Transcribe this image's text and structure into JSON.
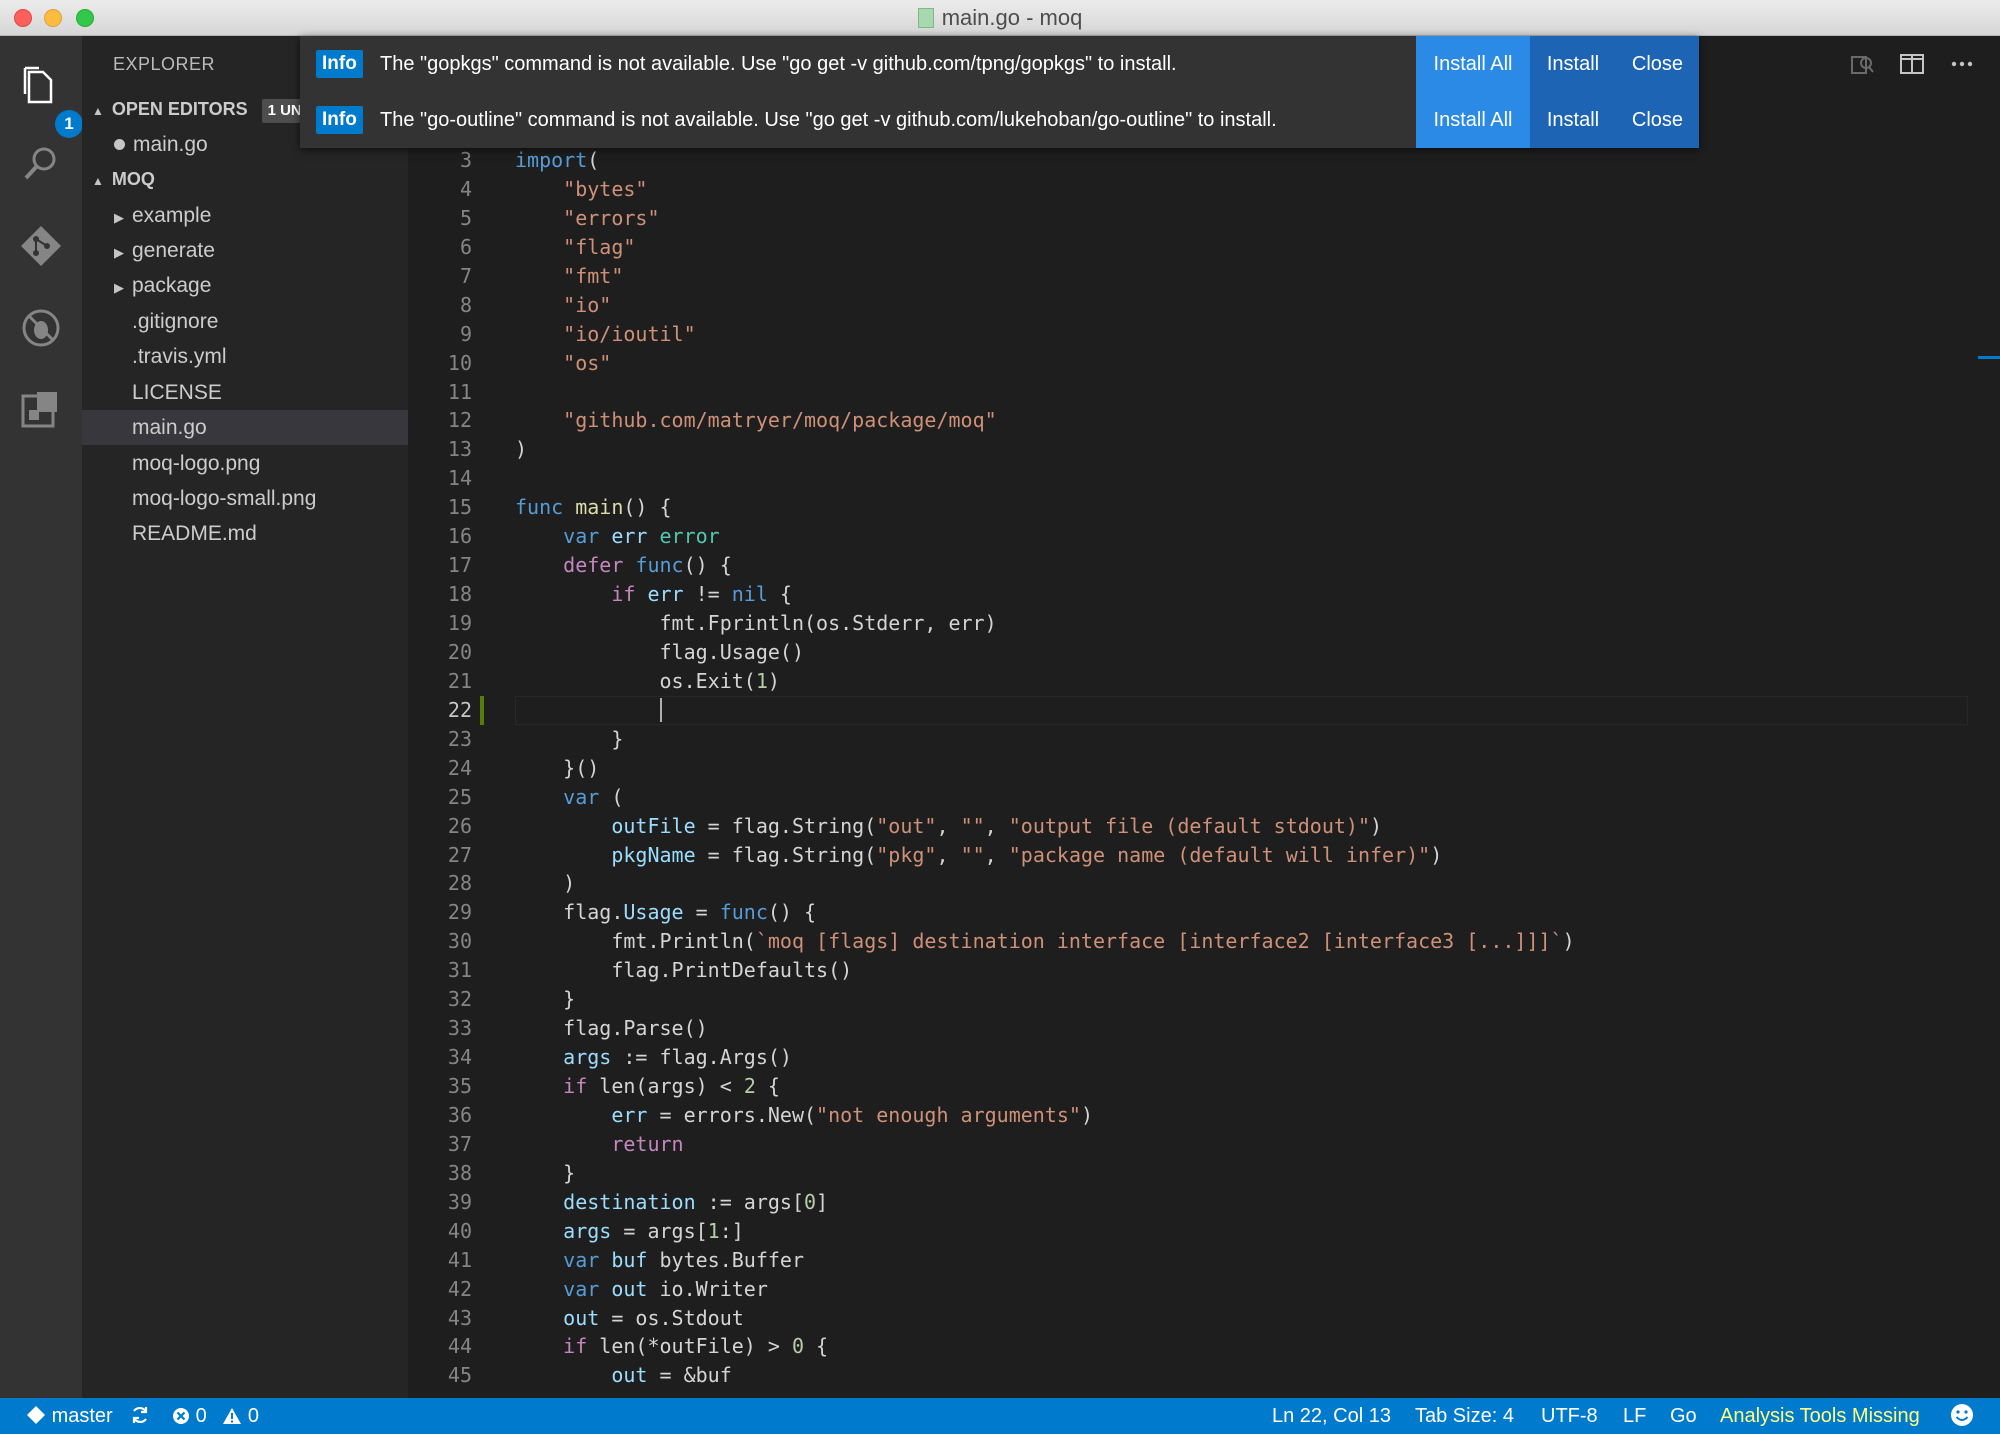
{
  "window": {
    "title": "main.go - moq"
  },
  "activity": {
    "explorer_badge": "1"
  },
  "sidebar": {
    "title": "EXPLORER",
    "open_editors": {
      "label": "OPEN EDITORS",
      "badge": "1 UN",
      "files": [
        {
          "name": "main.go"
        }
      ]
    },
    "folder": {
      "label": "MOQ",
      "items": [
        {
          "name": "example",
          "type": "folder"
        },
        {
          "name": "generate",
          "type": "folder"
        },
        {
          "name": "package",
          "type": "folder"
        },
        {
          "name": ".gitignore",
          "type": "file"
        },
        {
          "name": ".travis.yml",
          "type": "file"
        },
        {
          "name": "LICENSE",
          "type": "file"
        },
        {
          "name": "main.go",
          "type": "file",
          "selected": true
        },
        {
          "name": "moq-logo.png",
          "type": "file"
        },
        {
          "name": "moq-logo-small.png",
          "type": "file"
        },
        {
          "name": "README.md",
          "type": "file"
        }
      ]
    }
  },
  "notifications": [
    {
      "tag": "Info",
      "message": "The \"gopkgs\" command is not available. Use \"go get -v github.com/tpng/gopkgs\" to install.",
      "install_all": "Install All",
      "install": "Install",
      "close": "Close"
    },
    {
      "tag": "Info",
      "message": "The \"go-outline\" command is not available. Use \"go get -v github.com/lukehoban/go-outline\" to install.",
      "install_all": "Install All",
      "install": "Install",
      "close": "Close"
    }
  ],
  "editor": {
    "first_line": 3,
    "current_line": 22,
    "lines": [
      [
        [
          "kw",
          "import"
        ],
        [
          "",
          "("
        ]
      ],
      [
        [
          "",
          "    "
        ],
        [
          "str",
          "\"bytes\""
        ]
      ],
      [
        [
          "",
          "    "
        ],
        [
          "str",
          "\"errors\""
        ]
      ],
      [
        [
          "",
          "    "
        ],
        [
          "str",
          "\"flag\""
        ]
      ],
      [
        [
          "",
          "    "
        ],
        [
          "str",
          "\"fmt\""
        ]
      ],
      [
        [
          "",
          "    "
        ],
        [
          "str",
          "\"io\""
        ]
      ],
      [
        [
          "",
          "    "
        ],
        [
          "str",
          "\"io/ioutil\""
        ]
      ],
      [
        [
          "",
          "    "
        ],
        [
          "str",
          "\"os\""
        ]
      ],
      [],
      [
        [
          "",
          "    "
        ],
        [
          "str",
          "\"github.com/matryer/moq/package/moq\""
        ]
      ],
      [
        [
          "",
          ")"
        ]
      ],
      [],
      [
        [
          "kw",
          "func"
        ],
        [
          "",
          " "
        ],
        [
          "fn",
          "main"
        ],
        [
          "",
          "() {"
        ]
      ],
      [
        [
          "",
          "    "
        ],
        [
          "kw",
          "var"
        ],
        [
          "",
          " "
        ],
        [
          "var",
          "err"
        ],
        [
          "",
          " "
        ],
        [
          "typ",
          "error"
        ]
      ],
      [
        [
          "",
          "    "
        ],
        [
          "ctl",
          "defer"
        ],
        [
          "",
          " "
        ],
        [
          "kw",
          "func"
        ],
        [
          "",
          "() {"
        ]
      ],
      [
        [
          "",
          "        "
        ],
        [
          "ctl",
          "if"
        ],
        [
          "",
          " "
        ],
        [
          "var",
          "err"
        ],
        [
          "",
          " != "
        ],
        [
          "kw",
          "nil"
        ],
        [
          "",
          " {"
        ]
      ],
      [
        [
          "",
          "            fmt.Fprintln(os.Stderr, err)"
        ]
      ],
      [
        [
          "",
          "            flag.Usage()"
        ]
      ],
      [
        [
          "",
          "            os.Exit("
        ],
        [
          "num",
          "1"
        ],
        [
          "",
          ")"
        ]
      ],
      [
        [
          "",
          "            "
        ],
        [
          "cursor",
          ""
        ]
      ],
      [
        [
          "",
          "        }"
        ]
      ],
      [
        [
          "",
          "    }()"
        ]
      ],
      [
        [
          "",
          "    "
        ],
        [
          "kw",
          "var"
        ],
        [
          "",
          " ("
        ]
      ],
      [
        [
          "",
          "        "
        ],
        [
          "var",
          "outFile"
        ],
        [
          "",
          " = flag.String("
        ],
        [
          "str",
          "\"out\""
        ],
        [
          "",
          ", "
        ],
        [
          "str",
          "\"\""
        ],
        [
          "",
          ", "
        ],
        [
          "str",
          "\"output file (default stdout)\""
        ],
        [
          "",
          ")"
        ]
      ],
      [
        [
          "",
          "        "
        ],
        [
          "var",
          "pkgName"
        ],
        [
          "",
          " = flag.String("
        ],
        [
          "str",
          "\"pkg\""
        ],
        [
          "",
          ", "
        ],
        [
          "str",
          "\"\""
        ],
        [
          "",
          ", "
        ],
        [
          "str",
          "\"package name (default will infer)\""
        ],
        [
          "",
          ")"
        ]
      ],
      [
        [
          "",
          "    )"
        ]
      ],
      [
        [
          "",
          "    flag."
        ],
        [
          "var",
          "Usage"
        ],
        [
          "",
          " = "
        ],
        [
          "kw",
          "func"
        ],
        [
          "",
          "() {"
        ]
      ],
      [
        [
          "",
          "        fmt.Println("
        ],
        [
          "str",
          "`moq [flags] destination interface [interface2 [interface3 [...]]]`"
        ],
        [
          "",
          ")"
        ]
      ],
      [
        [
          "",
          "        flag.PrintDefaults()"
        ]
      ],
      [
        [
          "",
          "    }"
        ]
      ],
      [
        [
          "",
          "    flag.Parse()"
        ]
      ],
      [
        [
          "",
          "    "
        ],
        [
          "var",
          "args"
        ],
        [
          "",
          " := flag.Args()"
        ]
      ],
      [
        [
          "",
          "    "
        ],
        [
          "ctl",
          "if"
        ],
        [
          "",
          " len(args) < "
        ],
        [
          "num",
          "2"
        ],
        [
          "",
          " {"
        ]
      ],
      [
        [
          "",
          "        "
        ],
        [
          "var",
          "err"
        ],
        [
          "",
          " = errors.New("
        ],
        [
          "str",
          "\"not enough arguments\""
        ],
        [
          "",
          ")"
        ]
      ],
      [
        [
          "",
          "        "
        ],
        [
          "ctl",
          "return"
        ]
      ],
      [
        [
          "",
          "    }"
        ]
      ],
      [
        [
          "",
          "    "
        ],
        [
          "var",
          "destination"
        ],
        [
          "",
          " := args["
        ],
        [
          "num",
          "0"
        ],
        [
          "",
          "]"
        ]
      ],
      [
        [
          "",
          "    "
        ],
        [
          "var",
          "args"
        ],
        [
          "",
          " = args["
        ],
        [
          "num",
          "1"
        ],
        [
          "",
          ":]"
        ]
      ],
      [
        [
          "",
          "    "
        ],
        [
          "kw",
          "var"
        ],
        [
          "",
          " "
        ],
        [
          "var",
          "buf"
        ],
        [
          "",
          " bytes.Buffer"
        ]
      ],
      [
        [
          "",
          "    "
        ],
        [
          "kw",
          "var"
        ],
        [
          "",
          " "
        ],
        [
          "var",
          "out"
        ],
        [
          "",
          " io.Writer"
        ]
      ],
      [
        [
          "",
          "    "
        ],
        [
          "var",
          "out"
        ],
        [
          "",
          " = os.Stdout"
        ]
      ],
      [
        [
          "",
          "    "
        ],
        [
          "ctl",
          "if"
        ],
        [
          "",
          " len(*outFile) > "
        ],
        [
          "num",
          "0"
        ],
        [
          "",
          " {"
        ]
      ],
      [
        [
          "",
          "        "
        ],
        [
          "var",
          "out"
        ],
        [
          "",
          " = &buf"
        ]
      ]
    ]
  },
  "statusbar": {
    "branch": "master",
    "errors": "0",
    "warnings": "0",
    "position": "Ln 22, Col 13",
    "tab_size": "Tab Size: 4",
    "encoding": "UTF-8",
    "eol": "LF",
    "language": "Go",
    "analysis": "Analysis Tools Missing"
  }
}
